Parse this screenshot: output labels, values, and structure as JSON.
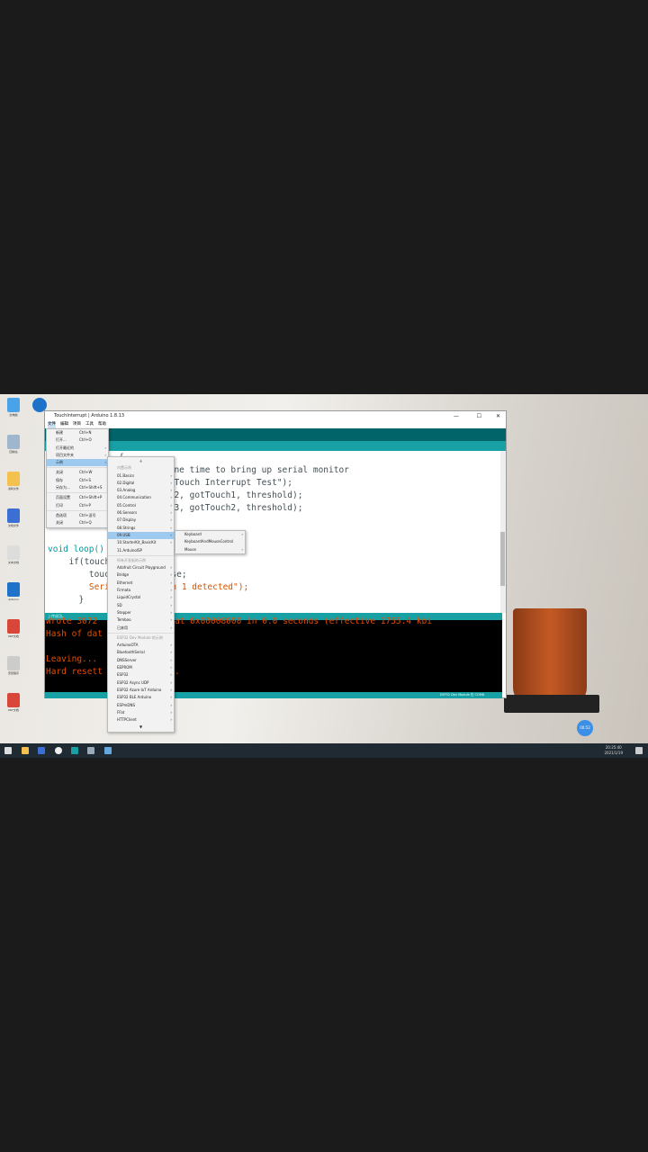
{
  "desktop_icons": [
    {
      "label": "此电脑",
      "color": "#4aa3e8"
    },
    {
      "label": "回收站",
      "color": "#9fb7cc"
    },
    {
      "label": "资料文件",
      "color": "#f2c14e"
    },
    {
      "label": "文档文件",
      "color": "#3b6fd4"
    },
    {
      "label": "文本文档",
      "color": "#dddddd"
    },
    {
      "label": "Arduino",
      "color": "#1e73c8"
    },
    {
      "label": "PDF文档",
      "color": "#d9473a"
    },
    {
      "label": "安装程序",
      "color": "#cccccc"
    },
    {
      "label": "PDF文档",
      "color": "#d9473a"
    }
  ],
  "window": {
    "title": "TouchInterrupt | Arduino 1.8.13",
    "controls": [
      "—",
      "☐",
      "✕"
    ]
  },
  "menubar": [
    "文件",
    "编辑",
    "项目",
    "工具",
    "帮助"
  ],
  "file_menu": [
    {
      "label": "新建",
      "shortcut": "Ctrl+N"
    },
    {
      "label": "打开...",
      "shortcut": "Ctrl+O"
    },
    {
      "label": "打开最近的",
      "arrow": "›"
    },
    {
      "label": "项目文件夹",
      "arrow": "›"
    },
    {
      "label": "示例",
      "arrow": "›",
      "selected": true
    },
    {
      "label": "关闭",
      "shortcut": "Ctrl+W"
    },
    {
      "label": "保存",
      "shortcut": "Ctrl+S"
    },
    {
      "label": "另存为...",
      "shortcut": "Ctrl+Shift+S"
    },
    {
      "label": "页面设置",
      "shortcut": "Ctrl+Shift+P"
    },
    {
      "label": "打印",
      "shortcut": "Ctrl+P"
    },
    {
      "label": "首选项",
      "shortcut": "Ctrl+逗号"
    },
    {
      "label": "关闭",
      "shortcut": "Ctrl+Q"
    }
  ],
  "examples_menu": {
    "scroll_up": "▲",
    "scroll_down": "▼",
    "builtin_header": "内置示例",
    "builtin": [
      "01.Basics",
      "02.Digital",
      "03.Analog",
      "04.Communication",
      "05.Control",
      "06.Sensors",
      "07.Display",
      "08.Strings",
      "09.USB",
      "10.StarterKit_BasicKit",
      "11.ArduinoISP"
    ],
    "selected": "09.USB",
    "all_boards_header": "所有开发板的示例",
    "all_boards": [
      "Adafruit Circuit Playground",
      "Bridge",
      "Ethernet",
      "Firmata",
      "LiquidCrystal",
      "SD",
      "Stepper",
      "Temboo",
      "已弃用"
    ],
    "board_header": "ESP32 Dev Module 的示例",
    "board": [
      "ArduinoOTA",
      "BluetoothSerial",
      "DNSServer",
      "EEPROM",
      "ESP32",
      "ESP32 Async UDP",
      "ESP32 Azure IoT Arduino",
      "ESP32 BLE Arduino",
      "ESPmDNS",
      "FFat",
      "HTTPClient"
    ]
  },
  "usb_submenu": [
    {
      "label": "Keyboard",
      "arrow": "›"
    },
    {
      "label": "KeyboardAndMouseControl"
    },
    {
      "label": "Mouse",
      "arrow": "›"
    }
  ],
  "code_lines": [
    "{",
    "  ne time to bring up serial monitor",
    "  Touch Interrupt Test\");",
    "  2, gotTouch1, threshold);",
    "  3, gotTouch2, threshold);",
    "}",
    "",
    "void loop()",
    "  if(touch1",
    "    touch1d         se;",
    "    Serial.         h 1 detected\");",
    "  }"
  ],
  "console_header": "上传成功。",
  "console_lines": [
    "Wrote 3072     mpressed) at 0x00008000 in 0.0 seconds (effective 1755.4 kbi",
    "Hash of dat",
    "",
    "Leaving...",
    "Hard resett          in..."
  ],
  "status": "ESP32 Dev Module 在 COM8",
  "badge": "00:52",
  "clock": {
    "time": "20:25:40",
    "date": "2021/1/19"
  },
  "colors": {
    "toolbar": "#006468",
    "tabs": "#17a1a5",
    "console_text": "#e34c00"
  }
}
